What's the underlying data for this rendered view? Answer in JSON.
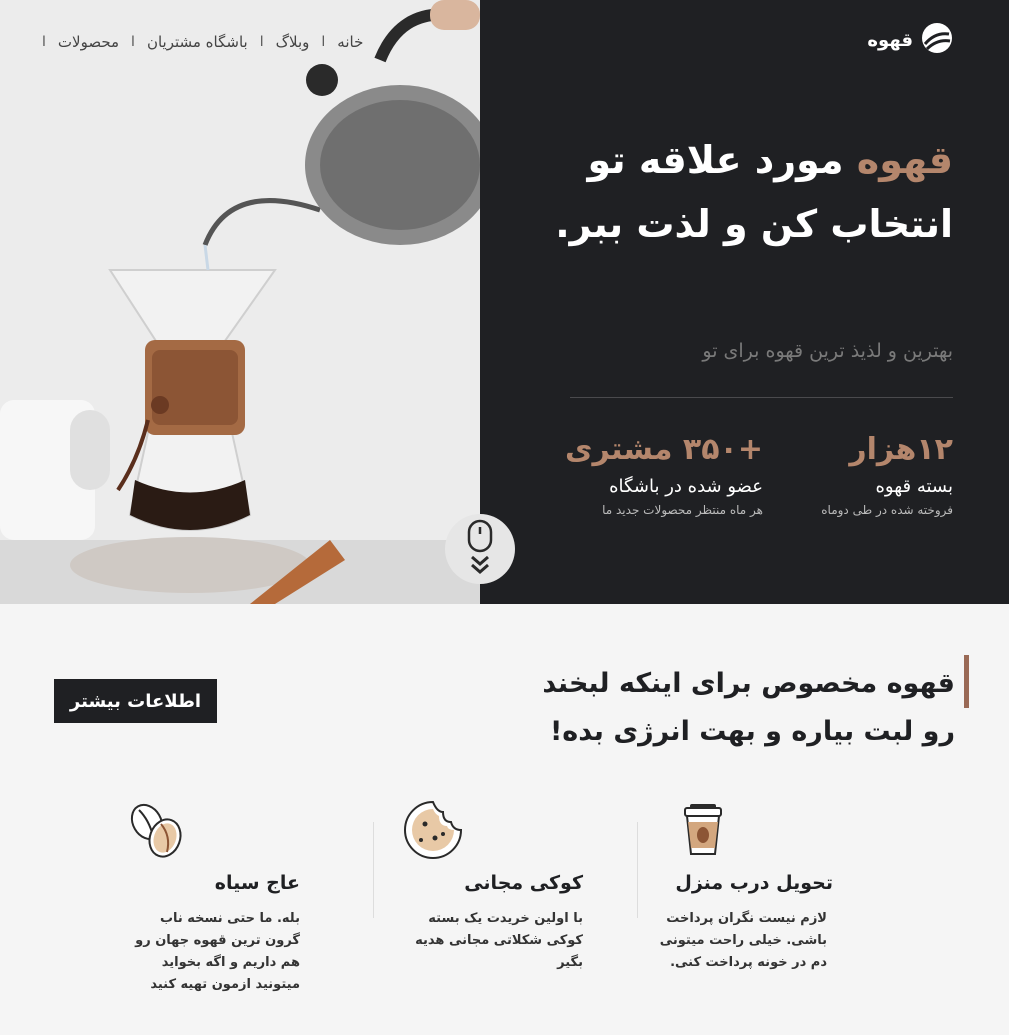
{
  "nav": {
    "items": [
      "خانه",
      "وبلاگ",
      "باشگاه مشتریان",
      "محصولات"
    ],
    "separator": "ا"
  },
  "logo": {
    "name": "قهوه",
    "icon": "coffee-bean-logo-icon"
  },
  "hero": {
    "headline_accent": "قهوه",
    "headline_rest": "مورد علاقه تو انتخاب کن و لذت ببر.",
    "subtitle": "بهترین و لذیذ ترین قهوه برای تو",
    "stats": [
      {
        "big": "۱۲هزار",
        "mid": "بسته قهوه",
        "small": "فروخته شده در طی دوماه"
      },
      {
        "big": "+۳۵۰ مشتری",
        "mid": "عضو شده در باشگاه",
        "small": "هر ماه منتظر محصولات جدید ما"
      }
    ],
    "scroll_icon": "mouse-scroll-down-icon"
  },
  "about": {
    "title": "قهوه مخصوص برای اینکه لبخند رو لبت بیاره و بهت انرژی بده!",
    "more_button": "اطلاعات بیشتر"
  },
  "features": [
    {
      "icon": "coffee-cup-icon",
      "title": "تحویل درب منزل",
      "desc": "لازم نیست نگران پرداخت باشی. خیلی راحت میتونی دم در خونه پرداخت کنی."
    },
    {
      "icon": "cookie-icon",
      "title": "کوکی مجانی",
      "desc": "با اولین خریدت یک بسته کوکی شکلاتی مجانی هدیه بگیر"
    },
    {
      "icon": "coffee-beans-icon",
      "title": "عاج سیاه",
      "desc": "بله. ما حتی نسخه ناب گرون ترین قهوه جهان رو هم داریم و اگه بخواید میتونید ازمون تهیه کنید"
    }
  ],
  "colors": {
    "dark": "#1f2023",
    "accent": "#b4866c",
    "bar": "#9a6a56"
  }
}
